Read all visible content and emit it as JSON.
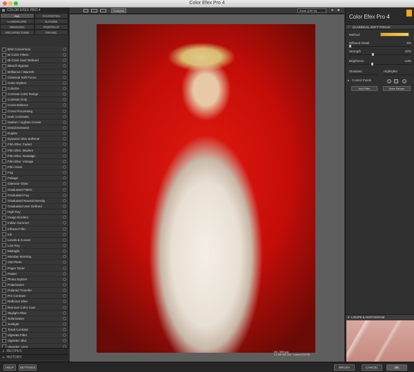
{
  "window": {
    "title": "Color Efex Pro 4"
  },
  "left_panel": {
    "header": "COLOR EFEX PRO 4",
    "categories": [
      "ALL",
      "FAVORITES",
      "LANDSCAPE",
      "NATURE",
      "WEDDING",
      "PORTRAIT",
      "ARCHITECTURE",
      "TRAVEL"
    ],
    "filters": [
      "B/W Conversion",
      "Bi-Color Filters",
      "Bi-Color User Defined",
      "Bleach Bypass",
      "Brilliance / Warmth",
      "Classical Soft Focus",
      "Color Stylizer",
      "Colorize",
      "Contrast Color Range",
      "Contrast Only",
      "Cross Balance",
      "Cross Processing",
      "Dark Contrasts",
      "Darken / Lighten Center",
      "Detail Extractor",
      "Duplex",
      "Dynamic Skin Softener",
      "Film Efex: Faded",
      "Film Efex: Modern",
      "Film Efex: Nostalgic",
      "Film Efex: Vintage",
      "Film Grain",
      "Fog",
      "Foliage",
      "Glamour Glow",
      "Graduated Filters",
      "Graduated Fog",
      "Graduated Neutral Density",
      "Graduated User Defined",
      "High Key",
      "Image Borders",
      "Indian Summer",
      "Infrared Film",
      "Ink",
      "Levels & Curves",
      "Low Key",
      "Midnight",
      "Monday Morning",
      "Old Photo",
      "Paper Toner",
      "Pastel",
      "Photo Stylizer",
      "Polarization",
      "Polaroid Transfer",
      "Pro Contrast",
      "Reflector Efex",
      "Remove Color Cast",
      "Skylight Filter",
      "Solarization",
      "Sunlight",
      "Tonal Contrast",
      "Vignette Filter",
      "Vignette: Blur",
      "Vignette: Lens",
      "White Neutralizer"
    ],
    "recipes_label": "RECIPES",
    "history_label": "HISTORY"
  },
  "toolbar": {
    "compare_label": "Compare",
    "zoom_label": "Zoom (100 %)"
  },
  "image": {
    "filename": "MG_0899.jpg",
    "meta": "f/-2 MP ISO 100 · Canon EOS 5D"
  },
  "right_panel": {
    "app_name": "Color Efex Pro",
    "app_version": "4",
    "filter_title": "CLASSICAL SOFT FOCUS",
    "params": [
      {
        "label": "Method",
        "value": ""
      },
      {
        "label": "Diffused Detail",
        "value": "0%",
        "level": 0
      },
      {
        "label": "Strength",
        "value": "37%",
        "level": 37
      },
      {
        "label": "Brightness",
        "value": "-14%",
        "level": 36
      }
    ],
    "shadows_label": "Shadows",
    "highlights_label": "Highlights",
    "control_points_label": "Control Points",
    "add_filter_label": "Add Filter",
    "save_recipe_label": "Save Recipe",
    "loupe_label": "LOUPE & HISTOGRAM"
  },
  "bottom": {
    "help_label": "HELP",
    "settings_label": "SETTINGS",
    "brush_label": "BRUSH",
    "cancel_label": "CANCEL",
    "ok_label": "OK"
  },
  "colors": {
    "accent": "#f0a814",
    "panel": "#303030",
    "canvas": "#5e5e5e"
  }
}
